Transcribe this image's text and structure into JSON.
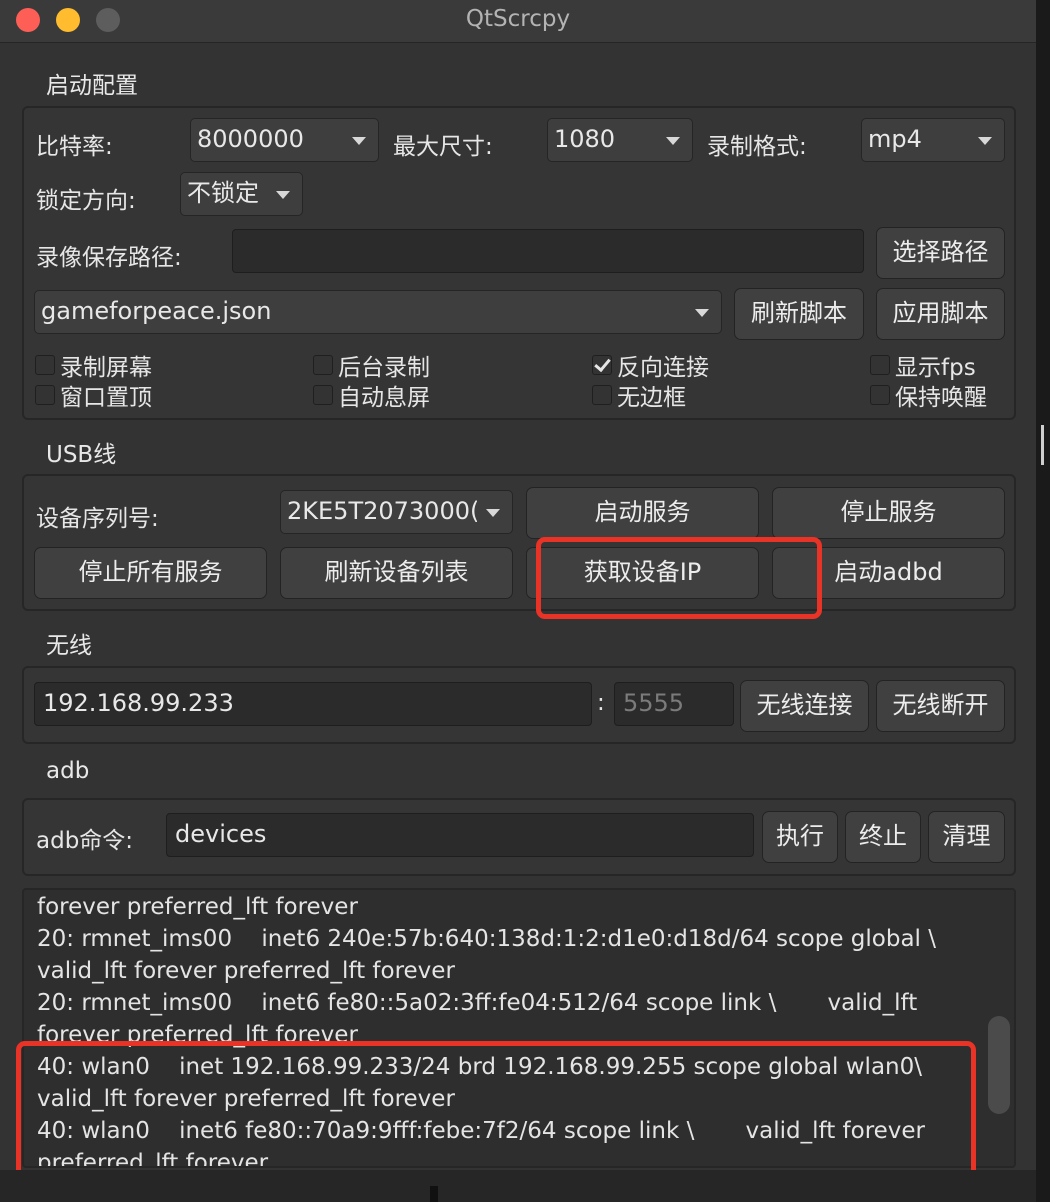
{
  "window": {
    "title": "QtScrcpy"
  },
  "config": {
    "title": "启动配置",
    "bitrate_label": "比特率:",
    "bitrate_value": "8000000",
    "maxsize_label": "最大尺寸:",
    "maxsize_value": "1080",
    "format_label": "录制格式:",
    "format_value": "mp4",
    "lock_label": "锁定方向:",
    "lock_value": "不锁定",
    "record_path_label": "录像保存路径:",
    "record_path_value": "",
    "select_path_button": "选择路径",
    "script_value": "gameforpeace.json",
    "refresh_script_button": "刷新脚本",
    "apply_script_button": "应用脚本",
    "checkboxes": [
      {
        "label": "录制屏幕",
        "checked": false
      },
      {
        "label": "后台录制",
        "checked": false
      },
      {
        "label": "反向连接",
        "checked": true
      },
      {
        "label": "显示fps",
        "checked": false
      },
      {
        "label": "窗口置顶",
        "checked": false
      },
      {
        "label": "自动息屏",
        "checked": false
      },
      {
        "label": "无边框",
        "checked": false
      },
      {
        "label": "保持唤醒",
        "checked": false
      }
    ]
  },
  "usb": {
    "title": "USB线",
    "serial_label": "设备序列号:",
    "serial_value": "2KE5T2073000(",
    "start_service_button": "启动服务",
    "stop_service_button": "停止服务",
    "stop_all_button": "停止所有服务",
    "refresh_devices_button": "刷新设备列表",
    "get_ip_button": "获取设备IP",
    "start_adbd_button": "启动adbd"
  },
  "wireless": {
    "title": "无线",
    "ip_value": "192.168.99.233",
    "colon": ":",
    "port_placeholder": "5555",
    "connect_button": "无线连接",
    "disconnect_button": "无线断开"
  },
  "adb": {
    "title": "adb",
    "command_label": "adb命令:",
    "command_value": "devices",
    "execute_button": "执行",
    "stop_button": "终止",
    "clear_button": "清理"
  },
  "console": {
    "lines": [
      "forever preferred_lft forever",
      "20: rmnet_ims00    inet6 240e:57b:640:138d:1:2:d1e0:d18d/64 scope global \\",
      "valid_lft forever preferred_lft forever",
      "20: rmnet_ims00    inet6 fe80::5a02:3ff:fe04:512/64 scope link \\       valid_lft",
      "forever preferred_lft forever",
      "40: wlan0    inet 192.168.99.233/24 brd 192.168.99.255 scope global wlan0\\",
      "valid_lft forever preferred_lft forever",
      "40: wlan0    inet6 fe80::70a9:9fff:febe:7f2/64 scope link \\       valid_lft forever",
      "preferred_lft forever"
    ]
  },
  "colors": {
    "highlight": "#e83326",
    "window_bg": "#333333"
  }
}
